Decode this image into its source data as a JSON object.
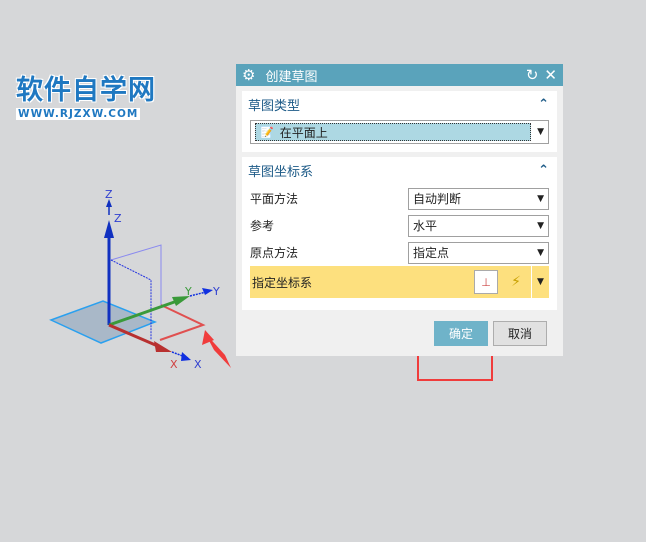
{
  "watermark": {
    "title": "软件自学网",
    "url": "WWW.RJZXW.COM"
  },
  "scene": {
    "axis_labels": {
      "z1": "Z",
      "z2": "Z",
      "y1": "Y",
      "y2": "Y",
      "x1": "X",
      "x2": "X"
    }
  },
  "dialog": {
    "title": "创建草图",
    "section_type": {
      "title": "草图类型",
      "value": "在平面上"
    },
    "section_csys": {
      "title": "草图坐标系",
      "rows": [
        {
          "label": "平面方法",
          "value": "自动判断"
        },
        {
          "label": "参考",
          "value": "水平"
        },
        {
          "label": "原点方法",
          "value": "指定点"
        }
      ],
      "specify_label": "指定坐标系"
    },
    "ok": "确定",
    "cancel": "取消"
  },
  "colors": {
    "titlebar": "#5aa3bb",
    "ok": "#6fb3c9",
    "highlight": "#fde07e",
    "annotation": "#f03c3c"
  }
}
